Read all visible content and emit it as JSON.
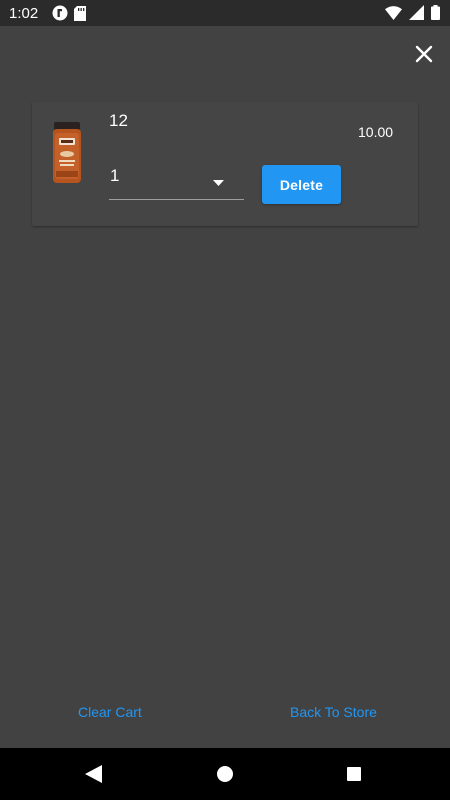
{
  "status_bar": {
    "time": "1:02",
    "left_icons": [
      "app-notification-icon",
      "sd-card-icon"
    ],
    "right_icons": [
      "wifi-icon",
      "signal-icon",
      "battery-icon"
    ]
  },
  "colors": {
    "background": "#424242",
    "card": "#454545",
    "accent": "#2196f3",
    "status_bar": "#2b2b2b",
    "nav_bar": "#000000"
  },
  "cart": {
    "items": [
      {
        "name": "12",
        "price": "10.00",
        "quantity": "1",
        "image_icon": "product-jar-image",
        "delete_label": "Delete"
      }
    ]
  },
  "footer": {
    "clear_cart_label": "Clear Cart",
    "back_to_store_label": "Back To Store"
  },
  "nav_bar": {
    "icons": [
      "back-icon",
      "home-icon",
      "recents-icon"
    ]
  }
}
